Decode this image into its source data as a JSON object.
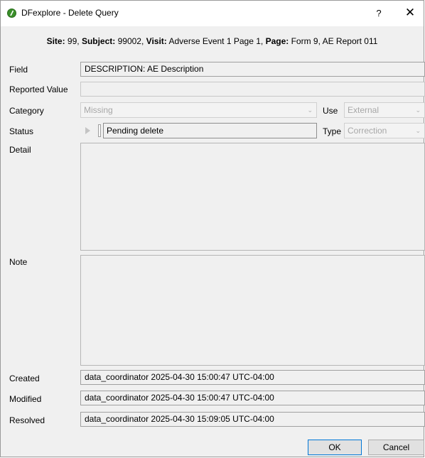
{
  "window": {
    "title": "DFexplore - Delete Query",
    "help_glyph": "?",
    "close_glyph": "✕"
  },
  "header": {
    "site_label": "Site:",
    "site_value": " 99,",
    "subject_label": "Subject:",
    "subject_value": " 99002,",
    "visit_label": "Visit:",
    "visit_value": " Adverse Event 1 Page 1,",
    "page_label": "Page:",
    "page_value": " Form 9, AE Report 011"
  },
  "form": {
    "field_label": "Field",
    "field_value": "DESCRIPTION: AE Description",
    "reported_label": "Reported Value",
    "reported_value": "",
    "category_label": "Category",
    "category_value": "Missing",
    "use_label": "Use",
    "use_value": "External",
    "status_label": "Status",
    "status_value": "Pending delete",
    "type_label": "Type",
    "type_value": "Correction",
    "detail_label": "Detail",
    "note_label": "Note",
    "created_label": "Created",
    "created_value": "data_coordinator 2025-04-30 15:00:47 UTC-04:00",
    "modified_label": "Modified",
    "modified_value": "data_coordinator 2025-04-30 15:00:47 UTC-04:00",
    "resolved_label": "Resolved",
    "resolved_value": "data_coordinator 2025-04-30 15:09:05 UTC-04:00"
  },
  "buttons": {
    "ok": "OK",
    "cancel": "Cancel"
  },
  "icons": {
    "app": "dfexplore-app-icon",
    "play": "play-icon",
    "chevron": "chevron-down-icon"
  },
  "colors": {
    "ok_border": "#0078d7",
    "app_icon": "#3a8f2a"
  }
}
